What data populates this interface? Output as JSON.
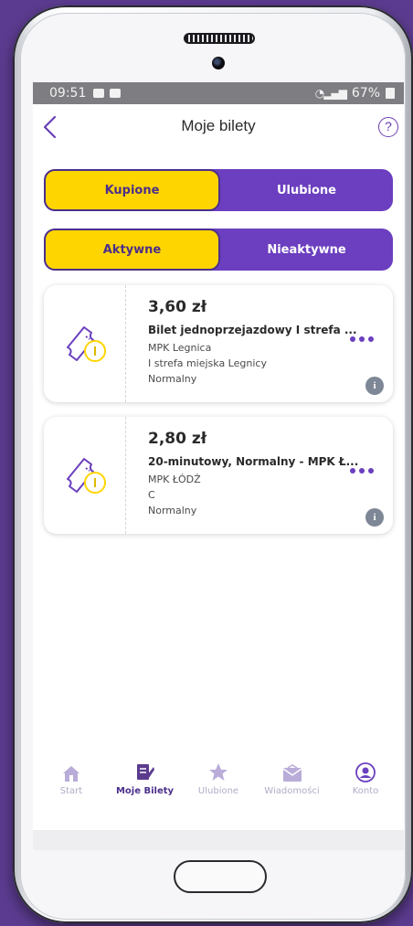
{
  "status_bar": {
    "time": "09:51",
    "battery": "67%"
  },
  "header": {
    "title": "Moje bilety",
    "help_label": "?"
  },
  "tabs_primary": [
    {
      "label": "Kupione",
      "active": true
    },
    {
      "label": "Ulubione",
      "active": false
    }
  ],
  "tabs_secondary": [
    {
      "label": "Aktywne",
      "active": true
    },
    {
      "label": "Nieaktywne",
      "active": false
    }
  ],
  "tickets": [
    {
      "price": "3,60 zł",
      "name": "Bilet jednoprzejazdowy I strefa ...",
      "operator": "MPK Legnica",
      "zone": "I strefa miejska Legnicy",
      "type": "Normalny"
    },
    {
      "price": "2,80 zł",
      "name": "20-minutowy, Normalny - MPK Ł...",
      "operator": "MPK ŁÓDŹ",
      "zone": "C",
      "type": "Normalny"
    }
  ],
  "nav": [
    {
      "label": "Start",
      "icon": "home-icon",
      "active": false
    },
    {
      "label": "Moje Bilety",
      "icon": "tickets-icon",
      "active": true
    },
    {
      "label": "Ulubione",
      "icon": "star-icon",
      "active": false
    },
    {
      "label": "Wiadomości",
      "icon": "envelope-icon",
      "active": false
    },
    {
      "label": "Konto",
      "icon": "account-icon",
      "active": false
    }
  ],
  "colors": {
    "accent": "#6b3fbf",
    "highlight": "#ffd500",
    "background": "#5b3b8f"
  }
}
